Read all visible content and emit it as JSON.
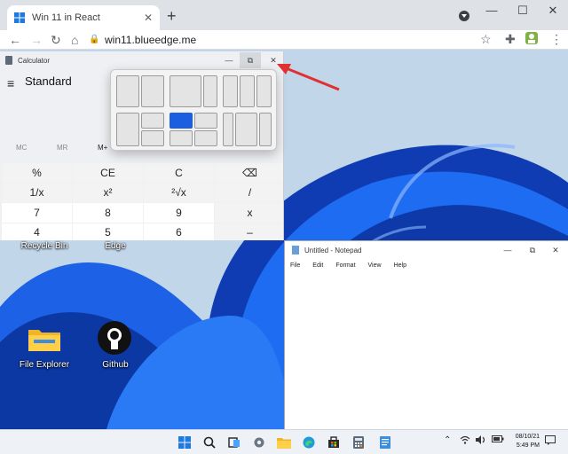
{
  "browser": {
    "tab_title": "Win 11 in React",
    "tab_close": "✕",
    "new_tab": "+",
    "url": "win11.blueedge.me",
    "minimize": "—",
    "maximize": "☐",
    "close": "✕"
  },
  "desktop_icons": {
    "recycle_bin": "Recycle Bin",
    "edge": "Edge",
    "file_explorer": "File Explorer",
    "github": "Github"
  },
  "calculator": {
    "title": "Calculator",
    "mode": "Standard",
    "min": "—",
    "restore": "⧉",
    "close": "✕",
    "memory": [
      "MC",
      "MR",
      "M+"
    ],
    "keys": [
      {
        "label": "%",
        "type": "op"
      },
      {
        "label": "CE",
        "type": "op"
      },
      {
        "label": "C",
        "type": "op"
      },
      {
        "label": "⌫",
        "type": "op"
      },
      {
        "label": "1/x",
        "type": "op"
      },
      {
        "label": "x²",
        "type": "op"
      },
      {
        "label": "²√x",
        "type": "op"
      },
      {
        "label": "/",
        "type": "op"
      },
      {
        "label": "7",
        "type": "num"
      },
      {
        "label": "8",
        "type": "num"
      },
      {
        "label": "9",
        "type": "num"
      },
      {
        "label": "x",
        "type": "op"
      },
      {
        "label": "4",
        "type": "num"
      },
      {
        "label": "5",
        "type": "num"
      },
      {
        "label": "6",
        "type": "num"
      },
      {
        "label": "–",
        "type": "op"
      }
    ]
  },
  "notepad": {
    "title": "Untitled - Notepad",
    "min": "—",
    "restore": "⧉",
    "close": "✕",
    "menu": [
      "File",
      "Edit",
      "Format",
      "View",
      "Help"
    ]
  },
  "taskbar": {
    "date": "08/10/21",
    "time": "5:49 PM"
  },
  "colors": {
    "accent": "#1a5fe0",
    "arrow": "#e0302f"
  }
}
